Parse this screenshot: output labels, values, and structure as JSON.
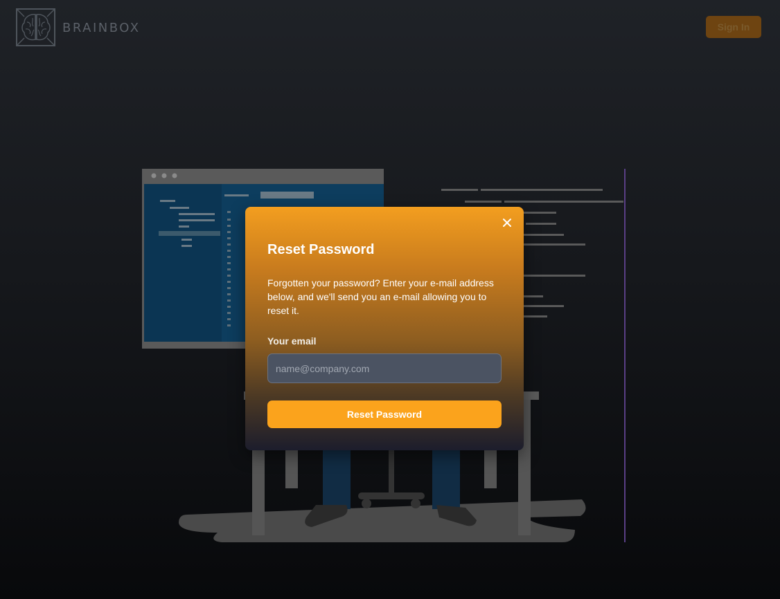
{
  "header": {
    "brand": "BRAINBOX",
    "signin_label": "Sign In"
  },
  "modal": {
    "title": "Reset Password",
    "description": "Forgotten your password? Enter your e-mail address below, and we'll send you an e-mail allowing you to reset it.",
    "email_label": "Your email",
    "email_placeholder": "name@company.com",
    "email_value": "",
    "submit_label": "Reset Password",
    "close_icon": "close-icon"
  },
  "colors": {
    "accent": "#fba31c",
    "signin_bg": "#6e4411",
    "input_bg": "#4b5362",
    "page_bg": "#1c1f24"
  }
}
